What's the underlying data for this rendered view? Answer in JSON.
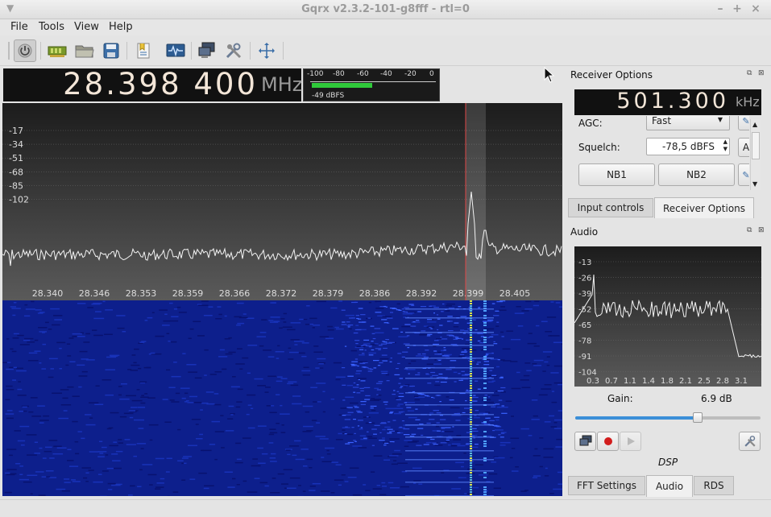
{
  "window": {
    "title": "Gqrx v2.3.2-101-g8fff - rtl=0"
  },
  "menu": {
    "file": "File",
    "tools": "Tools",
    "view": "View",
    "help": "Help"
  },
  "toolbar": {
    "icons": [
      "power-icon",
      "sdr-device-icon",
      "open-folder-icon",
      "save-icon",
      "bookmark-icon",
      "scope-icon",
      "network-icon",
      "tools-icon",
      "fullscreen-icon"
    ]
  },
  "frequency": {
    "value": "28.398 400",
    "unit": "MHz"
  },
  "meter": {
    "scale": [
      "-100",
      "-80",
      "-60",
      "-40",
      "-20",
      "0"
    ],
    "level_dbfs": -49,
    "label": "-49 dBFS"
  },
  "plotter": {
    "y_ticks": [
      "-17",
      "-34",
      "-51",
      "-68",
      "-85",
      "-102"
    ],
    "x_ticks": [
      "28.340",
      "28.346",
      "28.353",
      "28.359",
      "28.366",
      "28.372",
      "28.379",
      "28.386",
      "28.392",
      "28.399",
      "28.405"
    ]
  },
  "receiver": {
    "title": "Receiver Options",
    "freq_value": "501.300",
    "freq_unit": "kHz",
    "agc_label": "AGC:",
    "agc_value": "Fast",
    "squelch_label": "Squelch:",
    "squelch_value": "-78,5 dBFS",
    "squelch_auto": "A",
    "nb1": "NB1",
    "nb2": "NB2"
  },
  "tabs_top": {
    "input_controls": "Input controls",
    "receiver_options": "Receiver Options"
  },
  "audio": {
    "title": "Audio",
    "y_ticks": [
      "-13",
      "-26",
      "-39",
      "-52",
      "-65",
      "-78",
      "-91",
      "-104"
    ],
    "x_ticks": [
      "0.3",
      "0.7",
      "1.1",
      "1.4",
      "1.8",
      "2.1",
      "2.5",
      "2.8",
      "3.1"
    ],
    "gain_label": "Gain:",
    "gain_value": "6.9 dB",
    "gain_fraction": 0.66,
    "dsp_label": "DSP"
  },
  "tabs_bottom": {
    "fft_settings": "FFT Settings",
    "audio": "Audio",
    "rds": "RDS"
  }
}
